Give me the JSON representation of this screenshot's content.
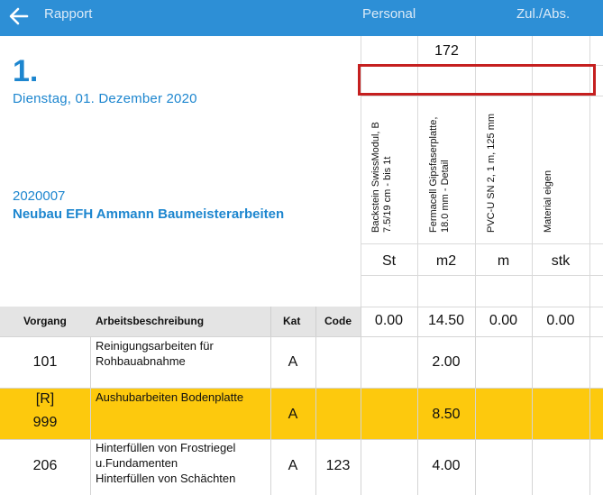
{
  "nav": {
    "back_icon": "arrow-left-icon",
    "title": "Rapport",
    "personal_tab": "Personal",
    "zul_tab": "Zul./Abs."
  },
  "report": {
    "number": "1.",
    "date": "Dienstag, 01. Dezember 2020",
    "project_number": "2020007",
    "project_name": "Neubau EFH Ammann Baumeisterarbeiten"
  },
  "materials": {
    "top_value": "172",
    "items": [
      {
        "name_line1": "Backstein SwissModul, B",
        "name_line2": "7.5/19 cm - bis 1t",
        "unit": "St",
        "total": "0.00"
      },
      {
        "name_line1": "Fermacell Gipsfaserplatte,",
        "name_line2": "18.0 mm - Detail",
        "unit": "m2",
        "total": "14.50"
      },
      {
        "name_line1": "PVC-U SN 2, 1 m, 125 mm",
        "name_line2": "",
        "unit": "m",
        "total": "0.00"
      },
      {
        "name_line1": "Material eigen",
        "name_line2": "",
        "unit": "stk",
        "total": "0.00"
      }
    ]
  },
  "table": {
    "headers": {
      "vorgang": "Vorgang",
      "beschreibung": "Arbeitsbeschreibung",
      "kat": "Kat",
      "code": "Code"
    },
    "rows": [
      {
        "vorgang_tag": "",
        "vorgang": "101",
        "desc": [
          "Reinigungsarbeiten für",
          "Rohbauabnahme"
        ],
        "kat": "A",
        "code": "",
        "qty": "2.00"
      },
      {
        "vorgang_tag": "[R]",
        "vorgang": "999",
        "desc": [
          "Aushubarbeiten Bodenplatte"
        ],
        "kat": "A",
        "code": "",
        "qty": "8.50"
      },
      {
        "vorgang_tag": "",
        "vorgang": "206",
        "desc": [
          "Hinterfüllen von Frostriegel",
          "u.Fundamenten",
          "Hinterfüllen von Schächten"
        ],
        "kat": "A",
        "code": "123",
        "qty": "4.00"
      }
    ]
  },
  "colors": {
    "nav": "#2d8fd6",
    "accent": "#1d86cf",
    "highlight": "#fdc90d",
    "selection": "#c51f1f"
  }
}
